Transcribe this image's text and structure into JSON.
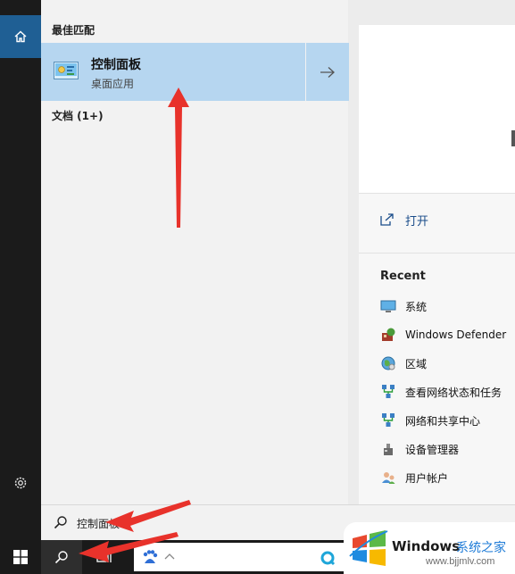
{
  "rail": {
    "icons": [
      "home-icon",
      "gear-icon"
    ]
  },
  "results": {
    "best_match_header": "最佳匹配",
    "best_match": {
      "title": "控制面板",
      "subtitle": "桌面应用"
    },
    "documents_header": "文档 (1+)"
  },
  "detail": {
    "open_label": "打开",
    "recent_header": "Recent",
    "recent_items": [
      {
        "label": "系统",
        "icon": "system-icon"
      },
      {
        "label": "Windows Defender",
        "icon": "defender-icon"
      },
      {
        "label": "区域",
        "icon": "region-icon"
      },
      {
        "label": "查看网络状态和任务",
        "icon": "network-icon"
      },
      {
        "label": "网络和共享中心",
        "icon": "network-icon"
      },
      {
        "label": "设备管理器",
        "icon": "device-manager-icon"
      },
      {
        "label": "用户帐户",
        "icon": "user-accounts-icon"
      }
    ]
  },
  "search": {
    "query": "控制面板"
  },
  "watermark": {
    "brand": "Windows",
    "cn": "系统之家",
    "url": "www.bjjmlv.com"
  },
  "colors": {
    "accent": "#1f5f94",
    "selection": "#b6d6f0",
    "arrow": "#e8322b"
  }
}
